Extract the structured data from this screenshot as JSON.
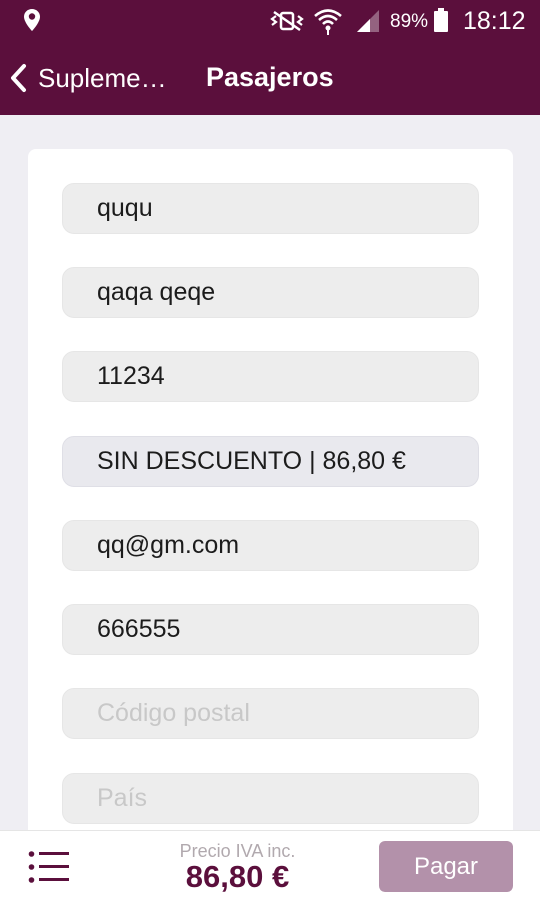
{
  "status_bar": {
    "battery": "89%",
    "time": "18:12"
  },
  "app_bar": {
    "back_label": "Supleme…",
    "title": "Pasajeros"
  },
  "form": {
    "fields": [
      {
        "value": "ququ"
      },
      {
        "value": "qaqa qeqe"
      },
      {
        "value": "11234"
      },
      {
        "value": "SIN DESCUENTO  |  86,80 €"
      },
      {
        "value": "qq@gm.com"
      },
      {
        "value": "666555"
      },
      {
        "placeholder": "Código postal"
      },
      {
        "placeholder": "País"
      }
    ]
  },
  "bottom_bar": {
    "price_label": "Precio IVA inc.",
    "price": "86,80 €",
    "pay_label": "Pagar"
  },
  "colors": {
    "brand": "#5b0f3c",
    "pay_button": "#b391aa"
  }
}
